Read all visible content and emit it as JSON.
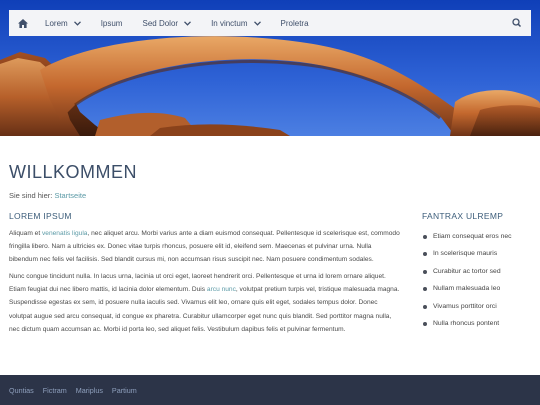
{
  "nav": {
    "items": [
      {
        "label": "Lorem",
        "has_dropdown": true
      },
      {
        "label": "Ipsum",
        "has_dropdown": false
      },
      {
        "label": "Sed Dolor",
        "has_dropdown": true
      },
      {
        "label": "In vinctum",
        "has_dropdown": true
      },
      {
        "label": "Proletra",
        "has_dropdown": false
      }
    ],
    "home_icon": "home-icon",
    "search_icon": "search-icon"
  },
  "page": {
    "title": "WILLKOMMEN",
    "breadcrumb_prefix": "Sie sind hier:",
    "breadcrumb_link": "Startseite"
  },
  "main": {
    "heading": "LOREM IPSUM",
    "p1": {
      "t1": "Aliquam et ",
      "link": "venenatis ligula",
      "t2": ", nec aliquet arcu. Morbi varius ante a diam euismod consequat. Pellentesque id scelerisque est, commodo fringilla libero. Nam a ultricies ex. Donec vitae turpis rhoncus, posuere elit id, eleifend sem. Maecenas et pulvinar urna. Nulla bibendum nec felis vel facilisis. Sed blandit cursus mi, non accumsan risus suscipit nec. Nam posuere condimentum sodales."
    },
    "p2": {
      "t1": "Nunc congue tincidunt nulla. In lacus urna, lacinia ut orci eget, laoreet hendrerit orci. Pellentesque et urna id lorem ornare aliquet. Etiam feugiat dui nec libero mattis, id lacinia dolor elementum. Duis ",
      "link": "arcu nunc",
      "t2": ", volutpat pretium turpis vel, tristique malesuada magna. Suspendisse egestas ex sem, id posuere nulla iaculis sed. Vivamus elit leo, ornare quis elit eget, sodales tempus dolor. Donec volutpat augue sed arcu consequat, id congue ex pharetra. Curabitur ullamcorper eget nunc quis blandit. Sed porttitor magna nulla, nec dictum quam accumsan ac. Morbi id porta leo, sed aliquet felis. Vestibulum dapibus felis et pulvinar fermentum."
    }
  },
  "sidebar": {
    "heading": "FANTRAX ULREMP",
    "items": [
      {
        "label": "Etiam consequat eros nec"
      },
      {
        "label": "In scelerisque mauris"
      },
      {
        "label": "Curabitur ac tortor sed"
      },
      {
        "label": "Nullam malesuada leo"
      },
      {
        "label": "Vivamus porttitor orci"
      },
      {
        "label": "Nulla rhoncus pontent"
      }
    ]
  },
  "footer": {
    "links": [
      {
        "label": "Quntias"
      },
      {
        "label": "Fictram"
      },
      {
        "label": "Mariplus"
      },
      {
        "label": "Partium"
      }
    ]
  },
  "colors": {
    "nav_bg": "#f3f4f7",
    "nav_text": "#3f4f6a",
    "link": "#5b9aa6",
    "footer_bg": "#2c3448",
    "footer_text": "#8fa0bd",
    "sky": "#1f4fc9",
    "rock": "#c0652b"
  }
}
